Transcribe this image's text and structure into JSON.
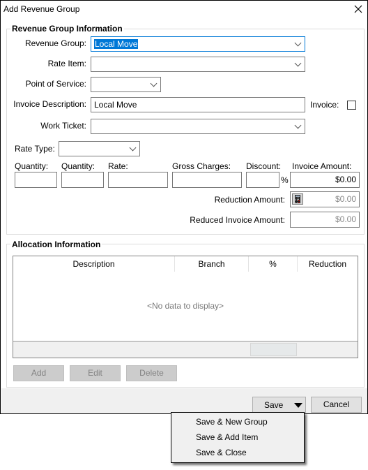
{
  "window": {
    "title": "Add Revenue Group"
  },
  "revenue_group_info": {
    "legend": "Revenue Group Information",
    "revenue_group": {
      "label": "Revenue Group:",
      "value": "Local Move"
    },
    "rate_item": {
      "label": "Rate Item:",
      "value": ""
    },
    "point_of_service": {
      "label": "Point of Service:",
      "value": ""
    },
    "invoice_description": {
      "label": "Invoice Description:",
      "value": "Local Move"
    },
    "invoice": {
      "label": "Invoice:",
      "checked": false
    },
    "work_ticket": {
      "label": "Work Ticket:",
      "value": ""
    },
    "rate_type": {
      "label": "Rate Type:",
      "value": ""
    },
    "quantity1": {
      "label": "Quantity:",
      "value": ""
    },
    "quantity2": {
      "label": "Quantity:",
      "value": ""
    },
    "rate": {
      "label": "Rate:",
      "value": ""
    },
    "gross_charges": {
      "label": "Gross Charges:",
      "value": ""
    },
    "discount": {
      "label": "Discount:",
      "value": "",
      "suffix": "%"
    },
    "invoice_amount": {
      "label": "Invoice Amount:",
      "value": "$0.00"
    },
    "reduction_amount": {
      "label": "Reduction Amount:",
      "value": "$0.00"
    },
    "reduced_invoice_amount": {
      "label": "Reduced Invoice Amount:",
      "value": "$0.00"
    }
  },
  "allocation_info": {
    "legend": "Allocation Information",
    "columns": [
      "Description",
      "Branch",
      "%",
      "Reduction"
    ],
    "rows": [],
    "empty_text": "<No data to display>",
    "buttons": {
      "add": "Add",
      "edit": "Edit",
      "delete": "Delete"
    }
  },
  "footer": {
    "save": "Save",
    "cancel": "Cancel"
  },
  "save_menu": {
    "items": [
      "Save & New Group",
      "Save & Add Item",
      "Save & Close"
    ]
  }
}
